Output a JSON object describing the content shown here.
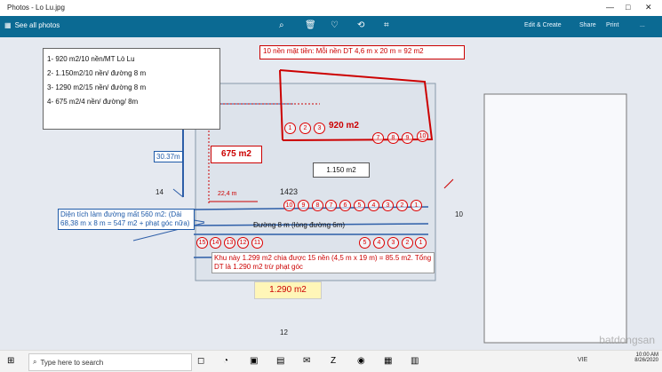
{
  "window": {
    "title": "Photos - Lo Lu.jpg"
  },
  "toolbar": {
    "see_all": "See all photos",
    "share": "Share",
    "edit": "Edit & Create",
    "print": "Print",
    "more": "..."
  },
  "notes": {
    "line1": "1- 920 m2/10 nền/MT Lò Lu",
    "line2": "2- 1.150m2/10 nền/ đường 8 m",
    "line3": "3- 1290 m2/15 nền/ đường 8 m",
    "line4": "4- 675 m2/4 nền/ đường/ 8m"
  },
  "labels": {
    "top_note": "10 nền mặt tiền: Mỗi nền DT 4,6 m x 20 m = 92 m2",
    "area_920": "920 m2",
    "area_675": "675 m2",
    "area_1150": "1.150 m2",
    "area_1290": "1.290 m2",
    "dim_30": "30.37m",
    "dim_22": "22,4 m",
    "road": "Đường 8 m (lòng đường 6m)",
    "road_note": "Diện tích làm đường mất 560 m2: (Dài 68,38 m x 8 m = 547 m2 + phạt góc nữa)",
    "bottom_note": "Khu này 1.299 m2 chia được 15 nền (4,5 m x 19 m) = 85.5 m2. Tổng DT là 1.290 m2 trừ phạt góc",
    "num_1423": "1423",
    "num_14": "14",
    "num_12": "12",
    "num_10": "10"
  },
  "top_lots": [
    "1",
    "2",
    "3",
    "7",
    "8",
    "9",
    "10"
  ],
  "mid_lots": [
    "10",
    "9",
    "8",
    "7",
    "6",
    "5",
    "4",
    "3",
    "2",
    "1"
  ],
  "bottom_lots": [
    "15",
    "14",
    "13",
    "12",
    "11",
    "5",
    "4",
    "3",
    "2",
    "1"
  ],
  "taskbar": {
    "search_placeholder": "Type here to search",
    "time": "10:00 AM",
    "date": "8/26/2020",
    "lang": "VIE"
  },
  "watermark": "batdongsan"
}
